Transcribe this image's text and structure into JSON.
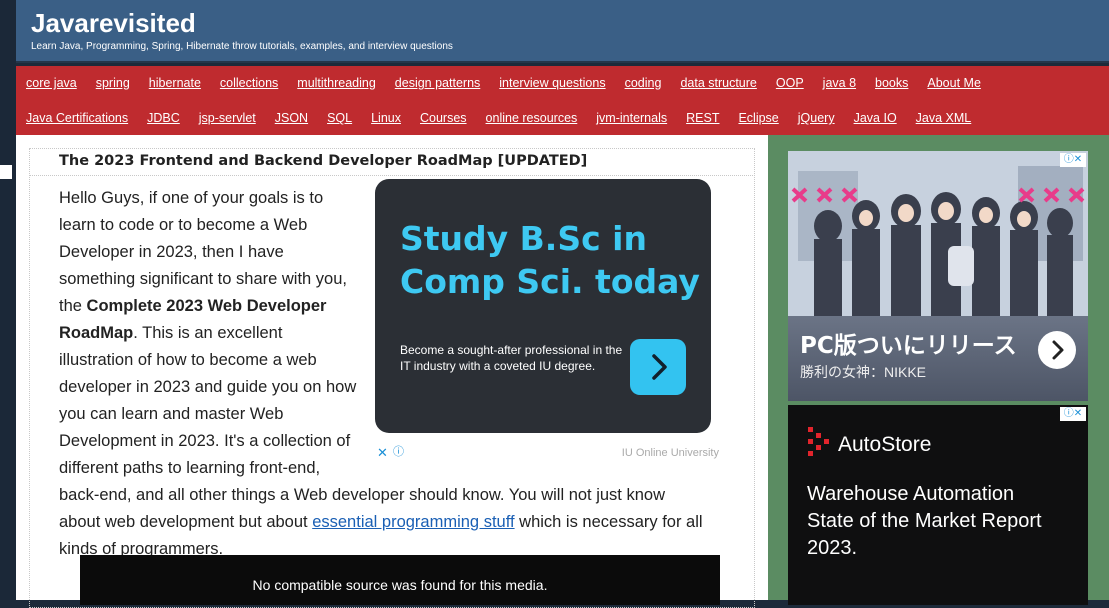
{
  "site": {
    "title": "Javarevisited",
    "description": "Learn Java, Programming, Spring, Hibernate throw tutorials, examples, and interview questions"
  },
  "nav": {
    "row1": [
      "core java",
      "spring",
      "hibernate",
      "collections",
      "multithreading",
      "design patterns",
      "interview questions",
      "coding",
      "data structure",
      "OOP",
      "java 8",
      "books",
      "About Me"
    ],
    "row2": [
      "Java Certifications",
      "JDBC",
      "jsp-servlet",
      "JSON",
      "SQL",
      "Linux",
      "Courses",
      "online resources",
      "jvm-internals",
      "REST",
      "Eclipse",
      "jQuery",
      "Java IO",
      "Java XML"
    ]
  },
  "post": {
    "title": "The 2023 Frontend and Backend Developer RoadMap [UPDATED]",
    "p_start": "Hello Guys, if one of your goals is to learn to code or to become a Web Developer in 2023, then I have something significant to share with you, the ",
    "p_bold": "Complete 2023 Web Developer RoadMap",
    "p_mid": ". This is an excellent illustration of how to become a web developer in 2023 and guide you on how you can learn and master Web Development in 2023. It's a collection of different paths to learning front-end, back-end, and all other things a Web developer should know.  You will not just know about web development but about ",
    "p_link": "essential programming stuff",
    "p_end": " which is necessary for all kinds of programmers."
  },
  "inline_ad": {
    "headline": "Study B.Sc in Comp Sci. today",
    "subtext": "Become a sought-after professional in the IT industry with a coveted IU degree.",
    "close": "✕",
    "info": "ⓘ",
    "sponsor": "IU Online University",
    "colors": {
      "bg": "#2b2f35",
      "accent": "#3ec9f2"
    }
  },
  "video": {
    "message": "No compatible source was found for this media."
  },
  "sidebar_ad_1": {
    "headline": "PC版ついにリリース",
    "sub": "勝利の女神：NIKKE",
    "adchoices": "ⓘ✕"
  },
  "sidebar_ad_2": {
    "brand": "AutoStore",
    "copy": "Warehouse Automation State of the Market Report 2023.",
    "adchoices": "ⓘ✕"
  },
  "colors": {
    "header": "#3a5f86",
    "nav": "#bf2b2f",
    "sidebar": "#5b8c62",
    "link": "#1a5fb4"
  }
}
